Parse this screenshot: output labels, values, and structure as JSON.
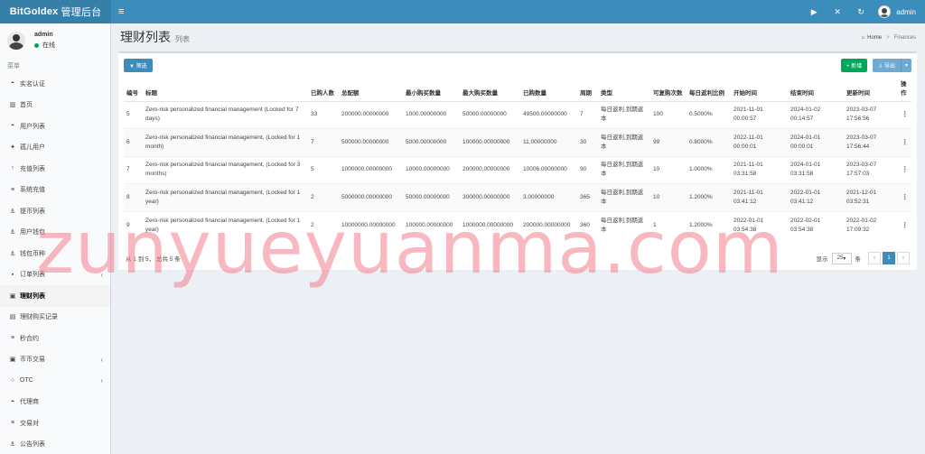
{
  "app": {
    "brand": "BitGoldex",
    "brand_sub": "管理后台"
  },
  "topbar": {
    "user_name": "admin",
    "icons": [
      "play-icon",
      "expand-icon",
      "refresh-icon"
    ],
    "color": "#3c8dbc"
  },
  "sidebar": {
    "user": {
      "name": "admin",
      "status": "在线"
    },
    "menu_header": "菜单",
    "items": [
      {
        "label": "实名认证",
        "icon": "◓"
      },
      {
        "label": "首页",
        "icon": "▥"
      },
      {
        "label": "用户列表",
        "icon": "◓"
      },
      {
        "label": "孤儿用户",
        "icon": "✦"
      },
      {
        "label": "充值列表",
        "icon": "↑"
      },
      {
        "label": "系统充值",
        "icon": "≡"
      },
      {
        "label": "提币列表",
        "icon": "⚓"
      },
      {
        "label": "用户钱包",
        "icon": "⚓"
      },
      {
        "label": "钱包币种",
        "icon": "⚓"
      },
      {
        "label": "订单列表",
        "icon": "▪",
        "chev": "‹"
      },
      {
        "label": "理财列表",
        "icon": "▣"
      },
      {
        "label": "理财购买记录",
        "icon": "▤"
      },
      {
        "label": "秒合约",
        "icon": "≡"
      },
      {
        "label": "币币交易",
        "icon": "▣",
        "chev": "‹"
      },
      {
        "label": "OTC",
        "icon": "○",
        "chev": "‹"
      },
      {
        "label": "代理商",
        "icon": "◓"
      },
      {
        "label": "交易对",
        "icon": "≡"
      },
      {
        "label": "公告列表",
        "icon": "⚓"
      }
    ],
    "active_index": 10
  },
  "header": {
    "title": "理财列表",
    "subtitle": "列表"
  },
  "breadcrumb": {
    "home": "Home",
    "current": "Finances"
  },
  "toolbar": {
    "filter_label": "▼ 筛选",
    "add_label": "+ 新增",
    "export_label": "⇩ 导出",
    "caret": "▾"
  },
  "table": {
    "headers": [
      "编号",
      "标题",
      "已购人数",
      "总配额",
      "最小购买数量",
      "最大购买数量",
      "已购数量",
      "周期",
      "类型",
      "可复购次数",
      "每日返利比例",
      "开始时间",
      "结束时间",
      "更新时间",
      "操作"
    ],
    "rows": [
      [
        "5",
        "Zero-risk personalized financial management (Locked for 7 days)",
        "33",
        "200000.00000000",
        "1000.00000000",
        "50000.00000000",
        "49500.00000000",
        "7",
        "每日返利,到期返本",
        "100",
        "0.5000%",
        "2021-11-01 00:00:57",
        "2024-01-02 00:14:57",
        "2023-03-07 17:56:56",
        "⋮"
      ],
      [
        "6",
        "Zero-risk personalized financial management, (Locked for 1 month)",
        "7",
        "500000.00000000",
        "5000.00000000",
        "100000.00000000",
        "11.00000000",
        "30",
        "每日返利,到期返本",
        "99",
        "0.8000%",
        "2022-11-01 00:00:01",
        "2024-01-01 00:00:01",
        "2023-03-07 17:56:44",
        "⋮"
      ],
      [
        "7",
        "Zero-risk personalized financial management, (Locked for 3 months)",
        "5",
        "1000000.00000000",
        "10000.00000000",
        "200000.00000000",
        "10006.00000000",
        "90",
        "每日返利,到期返本",
        "10",
        "1.0000%",
        "2021-11-01 03:31:58",
        "2024-01-01 03:31:58",
        "2023-03-07 17:57:03",
        "⋮"
      ],
      [
        "8",
        "Zero-risk personalized financial management, (Locked for 1 year)",
        "2",
        "5000000.00000000",
        "50000.00000000",
        "300000.00000000",
        "3.00000000",
        "365",
        "每日返利,到期返本",
        "10",
        "1.2000%",
        "2021-11-01 03:41:12",
        "2022-01-01 03:41:12",
        "2021-12-01 03:52:31",
        "⋮"
      ],
      [
        "9",
        "Zero-risk personalized financial management, (Locked for 1 year)",
        "2",
        "10000000.00000000",
        "100000.00000000",
        "1000000.00000000",
        "200000.00000000",
        "360",
        "每日返利,到期返本",
        "1",
        "1.2000%",
        "2022-01-01 03:54:38",
        "2022-02-01 03:54:38",
        "2022-01-02 17:09:32",
        "⋮"
      ]
    ]
  },
  "pager": {
    "summary": "从 1 到 5， 总共 5 条",
    "show_label": "显示",
    "page_size": "25",
    "per_label": "条",
    "prev": "‹",
    "current_page": "1",
    "next": "›"
  },
  "watermark": "zunyueyuanma.com"
}
